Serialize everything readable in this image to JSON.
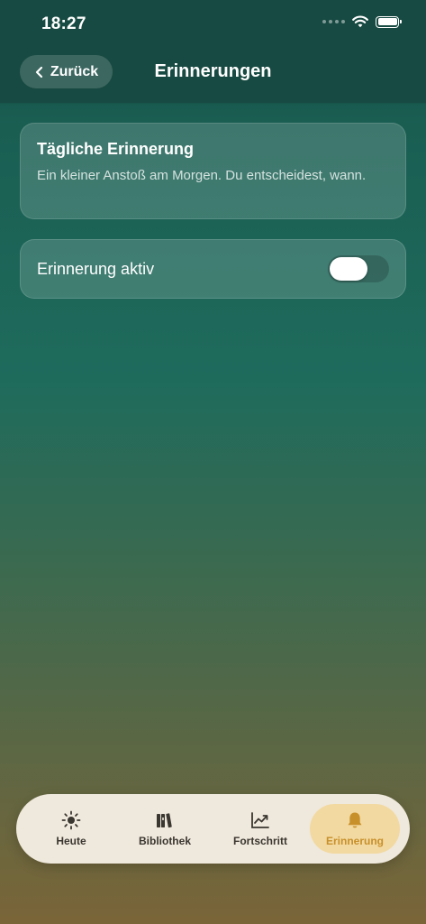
{
  "status_bar": {
    "time": "18:27"
  },
  "nav": {
    "back_label": "Zurück",
    "title": "Erinnerungen"
  },
  "info_card": {
    "title": "Tägliche Erinnerung",
    "description": "Ein kleiner Anstoß am Morgen. Du entscheidest, wann."
  },
  "toggle_card": {
    "label": "Erinnerung aktiv",
    "enabled": false
  },
  "tabs": [
    {
      "label": "Heute",
      "icon": "sun-icon",
      "active": false
    },
    {
      "label": "Bibliothek",
      "icon": "books-icon",
      "active": false
    },
    {
      "label": "Fortschritt",
      "icon": "chart-icon",
      "active": false
    },
    {
      "label": "Erinnerung",
      "icon": "bell-icon",
      "active": true
    }
  ],
  "colors": {
    "nav_background": "#174a42",
    "tab_bar_background": "#efe8dc",
    "active_tab_background": "#f2d9a1",
    "active_tab_text": "#c8902a"
  }
}
